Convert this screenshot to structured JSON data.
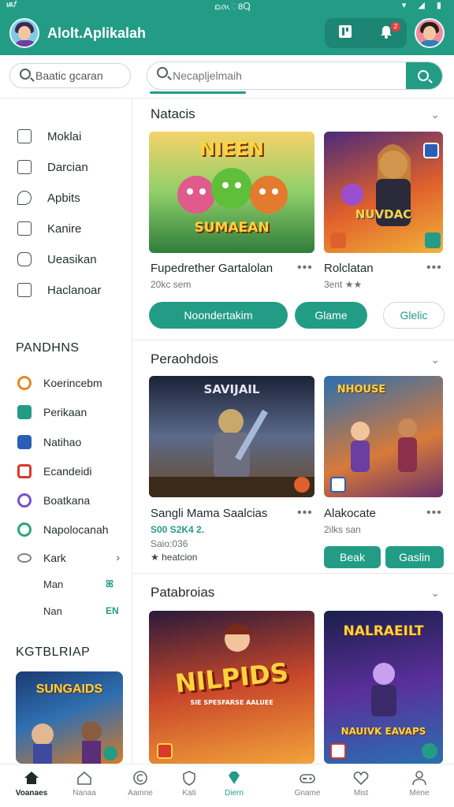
{
  "status_bar": {
    "left": "ѭ𝑓",
    "center": "ᨳᨩᨙ8Ⴓ",
    "right": "▾ ◢ ▮"
  },
  "app": {
    "title": "Alolt.Aplikalah",
    "accent": "#239c86",
    "notification_count": "2"
  },
  "search": {
    "secondary_value": "Baatic gcaran",
    "main_placeholder": "Necapljelmaih"
  },
  "sidebar": {
    "nav": [
      {
        "label": "Moklai",
        "icon": "grid-icon"
      },
      {
        "label": "Darcian",
        "icon": "calendar-check-icon"
      },
      {
        "label": "Apbits",
        "icon": "chat-bubble-icon"
      },
      {
        "label": "Kanire",
        "icon": "image-icon"
      },
      {
        "label": "Ueasikan",
        "icon": "gamepad-icon"
      },
      {
        "label": "Haclanoar",
        "icon": "edit-icon"
      }
    ],
    "platform_heading": "PANDHNS",
    "platforms": [
      {
        "label": "Koerincebm",
        "icon": "orange-ring-icon",
        "color": "#e08a1e"
      },
      {
        "label": "Perikaan",
        "icon": "green-square-icon",
        "color": "#239c86"
      },
      {
        "label": "Natihao",
        "icon": "blue-square-icon",
        "color": "#2a5fb8"
      },
      {
        "label": "Ecandeidi",
        "icon": "red-square-icon",
        "color": "#d9382d"
      },
      {
        "label": "Boatkana",
        "icon": "purple-ring-icon",
        "color": "#7a4fd0"
      },
      {
        "label": "Napolocanah",
        "icon": "green-ring-icon",
        "color": "#2fa37e"
      },
      {
        "label": "Kark",
        "icon": "grey-oval-icon",
        "color": "#7b8582"
      }
    ],
    "sub_items": [
      {
        "label": "Man",
        "tag": "ꕤ"
      },
      {
        "label": "Nan",
        "tag": "EN"
      }
    ],
    "featured_heading": "KGTBLRIAP",
    "featured_banner_title": "SUNGAIDS"
  },
  "sections": [
    {
      "title": "Natacis",
      "cards": [
        {
          "art_title": "NIEEN",
          "art_subtitle": "SUMAEAN",
          "name": "Fupedrether Gartalolan",
          "meta": "20kc sem"
        },
        {
          "art_title": "NUVDAC",
          "name": "Rolclatan",
          "meta": "3ent ★★"
        }
      ],
      "buttons": [
        "Noondertakim",
        "Glame",
        "Glelic"
      ]
    },
    {
      "title": "Peraohdois",
      "cards": [
        {
          "art_title": "SAVIJAIL",
          "name": "Sangli Mama Saalcias",
          "meta": "S00 S2K4 2.",
          "meta2": "Saio:036",
          "meta3": "★ heatcion"
        },
        {
          "art_title": "NHOUSE",
          "name": "Alakocate",
          "meta": "2ilks san"
        }
      ],
      "buttons": [
        "Beak",
        "Gaslin"
      ]
    },
    {
      "title": "Patabroias",
      "cards": [
        {
          "art_title": "NILPIDS",
          "art_subtitle": "SIE SPESFARSE AALUEE"
        },
        {
          "art_title": "NALRAEILT",
          "art_subtitle": "NAUIVK EAVAPS"
        }
      ]
    }
  ],
  "bottom_nav": [
    {
      "label": "Voanaes",
      "icon": "home-filled-icon",
      "active": true
    },
    {
      "label": "Nanaa",
      "icon": "home-outline-icon"
    },
    {
      "label": "Aamne",
      "icon": "circle-c-icon"
    },
    {
      "label": "Kati",
      "icon": "shield-icon"
    },
    {
      "label": "Diern",
      "icon": "diamond-icon"
    },
    {
      "label": "Gname",
      "icon": "controller-icon"
    },
    {
      "label": "Mist",
      "icon": "heart-icon"
    },
    {
      "label": "Mene",
      "icon": "user-icon"
    }
  ]
}
